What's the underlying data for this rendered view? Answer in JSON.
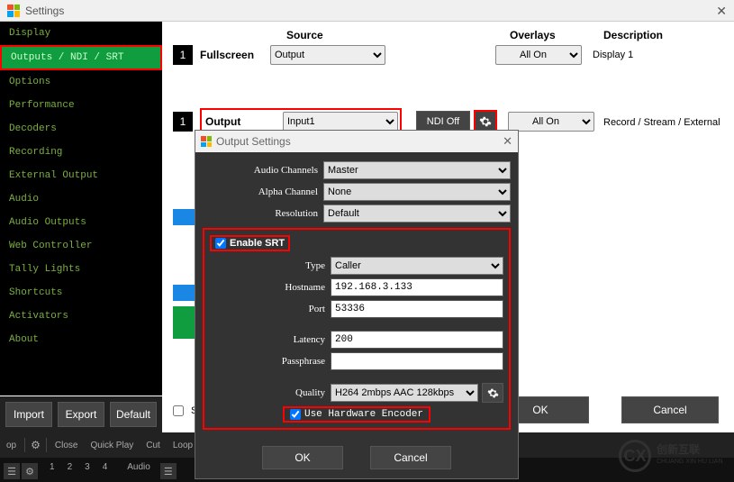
{
  "titlebar": {
    "title": "Settings"
  },
  "sidebar": {
    "items": [
      "Display",
      "Outputs / NDI / SRT",
      "Options",
      "Performance",
      "Decoders",
      "Recording",
      "External Output",
      "Audio",
      "Audio Outputs",
      "Web Controller",
      "Tally Lights",
      "Shortcuts",
      "Activators",
      "About"
    ],
    "selected_index": 1,
    "import": "Import",
    "export": "Export",
    "default": "Default"
  },
  "columns": {
    "source": "Source",
    "overlays": "Overlays",
    "description": "Description"
  },
  "row1": {
    "num": "1",
    "label": "Fullscreen",
    "source": "Output",
    "overlay": "All On",
    "desc": "Display 1"
  },
  "row2": {
    "num": "1",
    "label": "Output",
    "source": "Input1",
    "ndi": "NDI Off",
    "overlay": "All On",
    "desc": "Record / Stream / External"
  },
  "footer_checkbox_label": "Sh",
  "buttons": {
    "ok": "OK",
    "cancel": "Cancel"
  },
  "strip": {
    "close": "Close",
    "quick_play": "Quick Play",
    "cut": "Cut",
    "loop": "Loop",
    "audio": "Audio",
    "nums": [
      "1",
      "2",
      "3",
      "4"
    ],
    "op": "op"
  },
  "dlg": {
    "title": "Output Settings",
    "audio_channels_label": "Audio Channels",
    "audio_channels_value": "Master",
    "alpha_channel_label": "Alpha Channel",
    "alpha_channel_value": "None",
    "resolution_label": "Resolution",
    "resolution_value": "Default",
    "enable_srt_label": "Enable SRT",
    "enable_srt_checked": true,
    "type_label": "Type",
    "type_value": "Caller",
    "hostname_label": "Hostname",
    "hostname_value": "192.168.3.133",
    "port_label": "Port",
    "port_value": "53336",
    "latency_label": "Latency",
    "latency_value": "200",
    "passphrase_label": "Passphrase",
    "passphrase_value": "",
    "quality_label": "Quality",
    "quality_value": "H264 2mbps AAC 128kbps",
    "hw_encoder_label": "Use Hardware Encoder",
    "hw_encoder_checked": true,
    "ok": "OK",
    "cancel": "Cancel"
  },
  "watermark": {
    "symbol": "CX",
    "text1": "创新互联",
    "text2": "CHUANG XIN HU LIAN"
  }
}
